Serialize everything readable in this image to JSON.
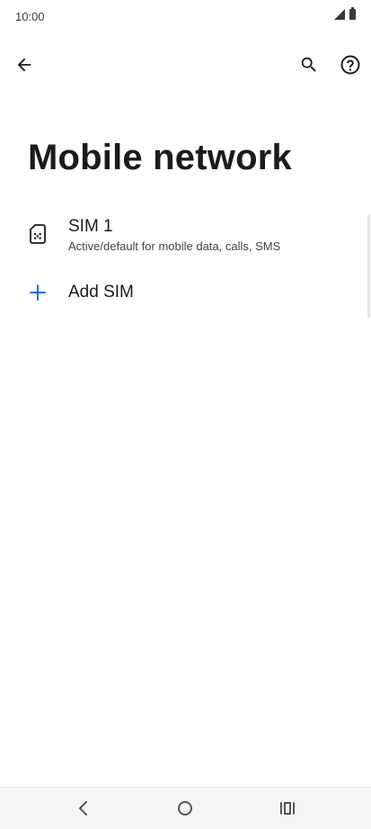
{
  "status_bar": {
    "time": "10:00",
    "icons": [
      "signal-icon",
      "battery-icon"
    ]
  },
  "toolbar": {
    "icons": [
      "back-arrow-icon",
      "search-icon",
      "help-icon"
    ]
  },
  "page": {
    "title": "Mobile network"
  },
  "list": {
    "items": [
      {
        "icon": "sim-card-icon",
        "title": "SIM 1",
        "subtitle": "Active/default for mobile data, calls, SMS"
      },
      {
        "icon": "plus-icon",
        "title": "Add SIM"
      }
    ]
  },
  "nav_bar": {
    "icons": [
      "nav-back-icon",
      "nav-home-icon",
      "nav-recents-icon"
    ]
  },
  "colors": {
    "accent": "#1a73c8",
    "text": "#1b1b1b",
    "nav_background": "#f6f6f6"
  }
}
